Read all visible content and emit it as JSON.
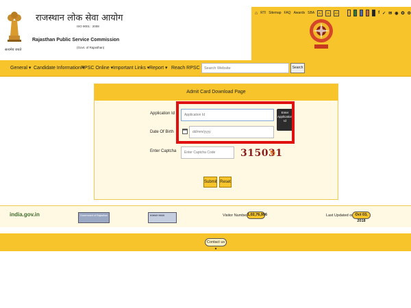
{
  "header": {
    "hindi_title": "राजस्थान लोक सेवा आयोग",
    "iso": "ISO 9001 : 2008",
    "eng_title": "Rajasthan Public Service Commission",
    "govt": "(Govt. of Rajasthan)",
    "emblem_caption": "सत्यमेव जयते"
  },
  "top_links": {
    "home_icon": "home-icon",
    "items": [
      "RTI",
      "Sitemap",
      "FAQ",
      "Awards",
      "SBA"
    ],
    "font_buttons": [
      "A-",
      "A",
      "A+"
    ],
    "color_boxes": [
      "#f2b829",
      "#2f7d36",
      "#4d6ab3",
      "#c96a2e",
      "#222222"
    ],
    "social_icons": [
      "facebook-icon",
      "twitter-icon",
      "email-icon",
      "rss-icon",
      "accessibility-icon",
      "settings-icon"
    ]
  },
  "nav": {
    "items": [
      "General ▾",
      "Candidate Information ▾",
      "RPSC Online ▾",
      "Important Links ▾",
      "Report ▾",
      "Reach RPSC ▾"
    ],
    "search_placeholder": "Search Website",
    "search_button": "Search"
  },
  "form": {
    "heading": "Admit Card Download Page",
    "application_label": "Application Id",
    "application_placeholder": "Application Id",
    "tooltip": "Enter Application Id",
    "dob_label": "Date Of Birth",
    "dob_placeholder": "dd/mm/yyyy",
    "captcha_label": "Enter Captcha",
    "captcha_placeholder": "Enter Captcha Code",
    "captcha_code": "315031",
    "submit": "Submit",
    "reset": "Reset"
  },
  "footer": {
    "india_logo": "india.gov.in",
    "logo_box_1": "Government of Rajasthan",
    "logo_box_2": "राजस्थान सरकार",
    "visitor_label": "Visitor Number :",
    "visitor_value": "1,02,76,996",
    "updated_label": "Last Updated on :",
    "updated_value": "Oct 03, 2018",
    "contact": "Contact us ▾"
  },
  "colors": {
    "accent": "#f7c52b",
    "highlight_border": "#e01010"
  }
}
